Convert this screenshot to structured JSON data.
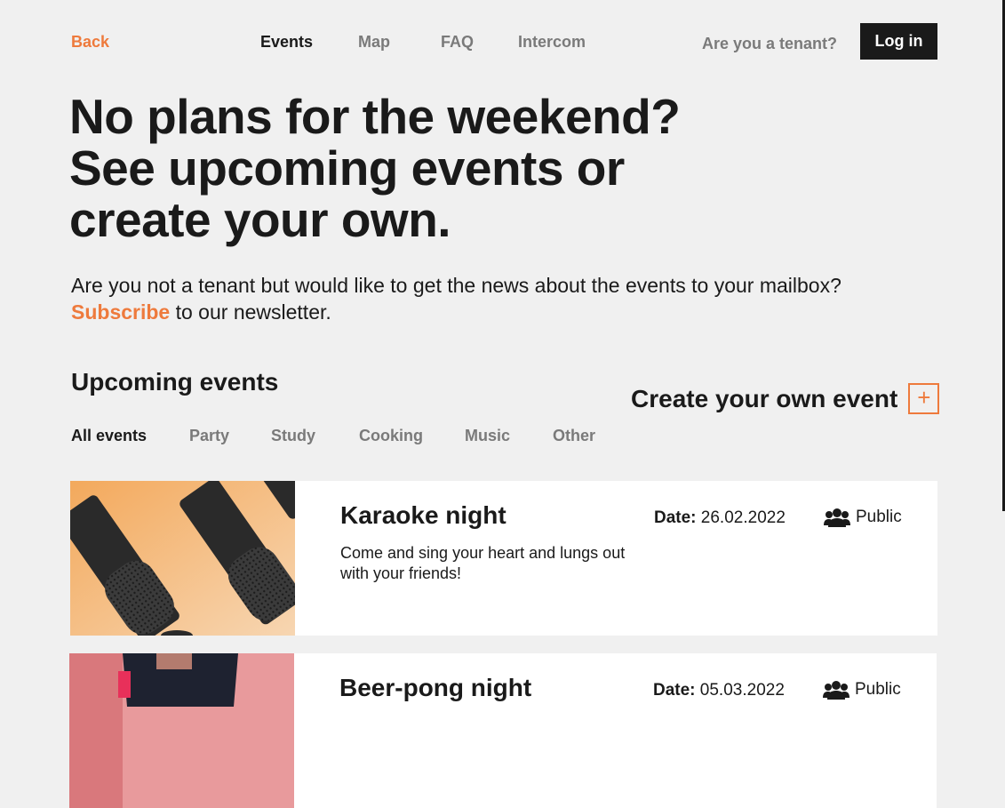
{
  "nav": {
    "back": "Back",
    "links": [
      "Events",
      "Map",
      "FAQ",
      "Intercom"
    ],
    "tenant_question": "Are you a tenant?",
    "login": "Log in"
  },
  "hero": {
    "line1": "No plans for the weekend?",
    "line2": "See upcoming events or",
    "line3": "create your own."
  },
  "newsletter": {
    "text": "Are you not a tenant but would like to get the news about the events to your mailbox?",
    "subscribe": "Subscribe",
    "suffix": " to our newsletter."
  },
  "events": {
    "heading": "Upcoming events",
    "create_label": "Create your own event",
    "create_icon": "+",
    "filters": [
      "All events",
      "Party",
      "Study",
      "Cooking",
      "Music",
      "Other"
    ],
    "items": [
      {
        "title": "Karaoke night",
        "description": "Come and sing your heart and lungs out with your friends!",
        "date_label": "Date:",
        "date": "26.02.2022",
        "visibility": "Public"
      },
      {
        "title": "Beer-pong night",
        "date_label": "Date:",
        "date": "05.03.2022",
        "visibility": "Public"
      }
    ]
  },
  "colors": {
    "accent": "#ee7a3c",
    "dark": "#1a1a1a",
    "muted": "#7a7a7a",
    "background": "#f0f0f0"
  },
  "icons": {
    "visibility": "people-icon",
    "create": "plus-icon"
  }
}
